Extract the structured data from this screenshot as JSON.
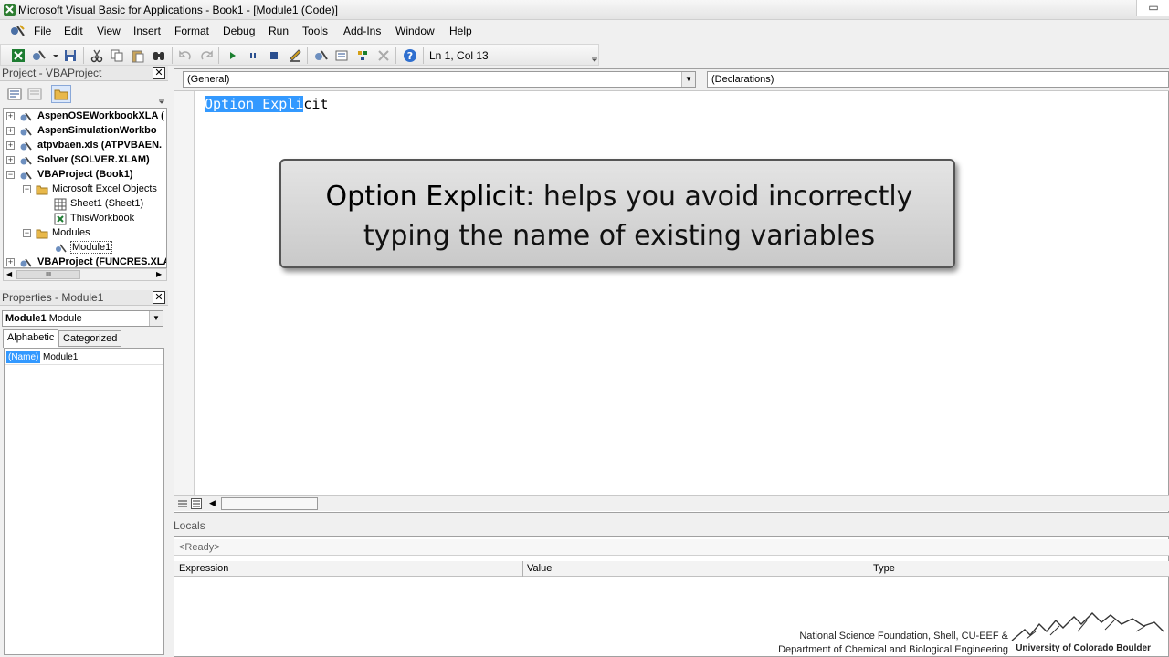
{
  "window": {
    "title": "Microsoft Visual Basic for Applications - Book1 - [Module1 (Code)]",
    "restore_glyph": "▭"
  },
  "menu": [
    {
      "id": "file",
      "label": "File"
    },
    {
      "id": "edit",
      "label": "Edit"
    },
    {
      "id": "view",
      "label": "View"
    },
    {
      "id": "insert",
      "label": "Insert"
    },
    {
      "id": "format",
      "label": "Format"
    },
    {
      "id": "debug",
      "label": "Debug"
    },
    {
      "id": "run",
      "label": "Run"
    },
    {
      "id": "tools",
      "label": "Tools"
    },
    {
      "id": "addins",
      "label": "Add-Ins"
    },
    {
      "id": "window",
      "label": "Window"
    },
    {
      "id": "help",
      "label": "Help"
    }
  ],
  "toolbar": {
    "cursor_position": "Ln 1, Col 13",
    "buttons": [
      "view-excel-icon",
      "insert-module-icon",
      "save-icon",
      "cut-icon",
      "copy-icon",
      "paste-icon",
      "find-icon",
      "undo-icon",
      "redo-icon",
      "run-icon",
      "break-icon",
      "reset-icon",
      "design-mode-icon",
      "project-explorer-icon",
      "properties-window-icon",
      "object-browser-icon",
      "toolbox-icon",
      "help-icon"
    ]
  },
  "project_panel": {
    "title": "Project - VBAProject",
    "close": "✕",
    "tree": [
      {
        "label": "AspenOSEWorkbookXLA (",
        "level": 0,
        "bold": true,
        "expander": "+"
      },
      {
        "label": "AspenSimulationWorkbo",
        "level": 0,
        "bold": true,
        "expander": "+"
      },
      {
        "label": "atpvbaen.xls (ATPVBAEN.",
        "level": 0,
        "bold": true,
        "expander": "+"
      },
      {
        "label": "Solver (SOLVER.XLAM)",
        "level": 0,
        "bold": true,
        "expander": "+"
      },
      {
        "label": "VBAProject (Book1)",
        "level": 0,
        "bold": true,
        "expander": "−"
      },
      {
        "label": "Microsoft Excel Objects",
        "level": 1,
        "bold": false,
        "expander": "−"
      },
      {
        "label": "Sheet1 (Sheet1)",
        "level": 2,
        "bold": false,
        "expander": ""
      },
      {
        "label": "ThisWorkbook",
        "level": 2,
        "bold": false,
        "expander": ""
      },
      {
        "label": "Modules",
        "level": 1,
        "bold": false,
        "expander": "−"
      },
      {
        "label": "Module1",
        "level": 2,
        "bold": false,
        "expander": ""
      },
      {
        "label": "VBAProject (FUNCRES.XLA",
        "level": 0,
        "bold": true,
        "expander": "+"
      }
    ],
    "scroll_thumb": "III"
  },
  "properties_panel": {
    "title": "Properties - Module1",
    "close": "✕",
    "object_name": "Module1",
    "object_type": "Module",
    "tabs": [
      "Alphabetic",
      "Categorized"
    ],
    "active_tab": 0,
    "rows": [
      {
        "name": "(Name)",
        "value": "Module1"
      }
    ]
  },
  "code_window": {
    "object_combo": "(General)",
    "procedure_combo": "(Declarations)",
    "code_selected": "Option Expli",
    "code_rest": "cit"
  },
  "callout": {
    "term": "Option Explicit",
    "text": ": helps you avoid incorrectly typing the name of existing variables"
  },
  "locals": {
    "title": "Locals",
    "status": "<Ready>",
    "columns": [
      "Expression",
      "Value",
      "Type"
    ]
  },
  "credit": {
    "line1": "National Science Foundation, Shell, CU-EEF &",
    "line2": "Department of Chemical and Biological Engineering",
    "university": "University of Colorado Boulder"
  }
}
